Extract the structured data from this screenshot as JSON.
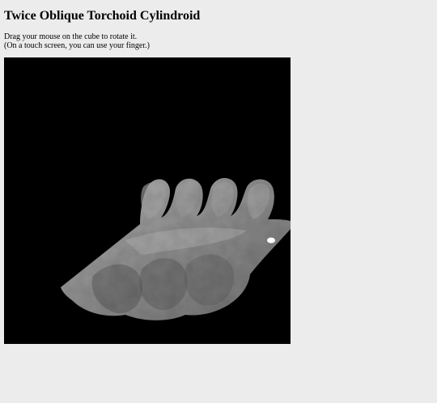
{
  "page": {
    "title": "Twice Oblique Torchoid Cylindroid",
    "instruction_line1": "Drag your mouse on the cube to rotate it.",
    "instruction_line2": "(On a touch screen, you can use your finger.)"
  },
  "viewer": {
    "background_color": "#000000",
    "surface_color": "#8a8a8a",
    "highlight_color": "#ffffff"
  },
  "colors": {
    "page_background": "#ececec",
    "text": "#000000"
  }
}
